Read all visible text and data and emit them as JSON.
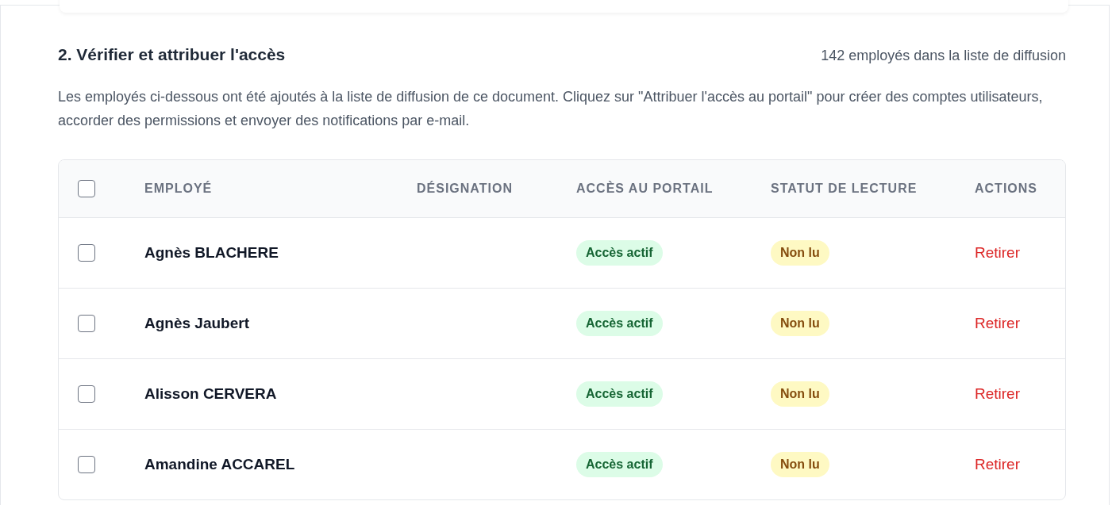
{
  "section": {
    "title": "2. Vérifier et attribuer l'accès",
    "count": "142 employés dans la liste de diffusion",
    "description": "Les employés ci-dessous ont été ajoutés à la liste de diffusion de ce document. Cliquez sur \"Attribuer l'accès au portail\" pour créer des comptes utilisateurs, accorder des permissions et envoyer des notifications par e-mail."
  },
  "table": {
    "select_all_checked": false,
    "columns": [
      "EMPLOYÉ",
      "DÉSIGNATION",
      "ACCÈS AU PORTAIL",
      "STATUT DE LECTURE",
      "ACTIONS"
    ],
    "rows": [
      {
        "checked": false,
        "name": "Agnès BLACHERE",
        "access": {
          "label": "Accès actif",
          "kind": "active"
        },
        "read": {
          "label": "Non lu",
          "kind": "unread"
        },
        "action": "Retirer"
      },
      {
        "checked": false,
        "name": "Agnès Jaubert",
        "access": {
          "label": "Accès actif",
          "kind": "active"
        },
        "read": {
          "label": "Non lu",
          "kind": "unread"
        },
        "action": "Retirer"
      },
      {
        "checked": false,
        "name": "Alisson CERVERA",
        "access": {
          "label": "Accès actif",
          "kind": "active"
        },
        "read": {
          "label": "Non lu",
          "kind": "unread"
        },
        "action": "Retirer"
      },
      {
        "checked": false,
        "name": "Amandine ACCAREL",
        "access": {
          "label": "Accès actif",
          "kind": "active"
        },
        "read": {
          "label": "Non lu",
          "kind": "unread"
        },
        "action": "Retirer"
      }
    ]
  }
}
